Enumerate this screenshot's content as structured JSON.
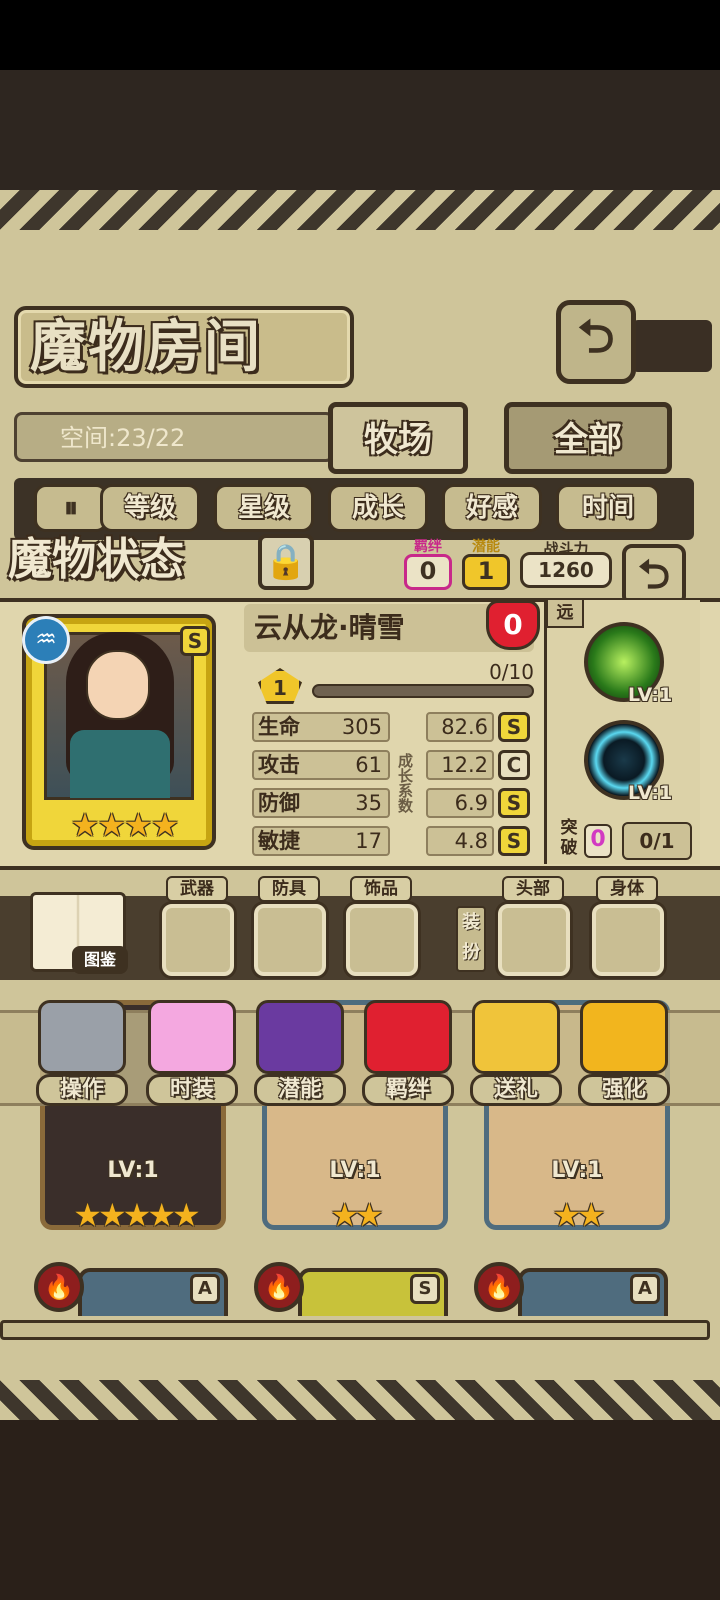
{
  "header": {
    "title": "魔物房间",
    "back_symbol": "⮌"
  },
  "space": {
    "label": "空间:23/22"
  },
  "tabs": [
    {
      "label": "牧场"
    },
    {
      "label": "全部"
    }
  ],
  "sort": {
    "toggle": "⏸",
    "options": [
      "等级",
      "星级",
      "成长",
      "好感",
      "时间"
    ]
  },
  "status": {
    "title": "魔物状态",
    "lock_symbol": "🔒",
    "bond_label": "羁绊",
    "bond_value": "0",
    "potential_label": "潜能",
    "potential_value": "1",
    "power_label": "战斗力",
    "power_value": "1260",
    "back_symbol": "⮌"
  },
  "monster": {
    "name": "云从龙·晴雪",
    "element_icon": "water-element-icon",
    "element_symbol": "♒",
    "grade": "S",
    "stars": "★★★★",
    "affection": "0",
    "level": "1",
    "xp": "0/10",
    "xp_fraction": 0.0,
    "range": "远",
    "growth_label": "成长系数",
    "stats": [
      {
        "label": "生命",
        "value": "305",
        "coef": "82.6",
        "grade": "S",
        "grade_color": "#f0d63a"
      },
      {
        "label": "攻击",
        "value": "61",
        "coef": "12.2",
        "grade": "C",
        "grade_color": "#e8dfbf"
      },
      {
        "label": "防御",
        "value": "35",
        "coef": "6.9",
        "grade": "S",
        "grade_color": "#f0d63a"
      },
      {
        "label": "敏捷",
        "value": "17",
        "coef": "4.8",
        "grade": "S",
        "grade_color": "#f0d63a"
      }
    ],
    "skills": [
      {
        "icon": "sword-slash-skill-icon",
        "level": "LV:1"
      },
      {
        "icon": "whirl-skill-icon",
        "level": "LV:1"
      }
    ],
    "breakthrough": {
      "label": "突破",
      "count": "0",
      "progress": "0/1"
    }
  },
  "equipment": {
    "book_label": "图鉴",
    "slots": [
      "武器",
      "防具",
      "饰品",
      "头部",
      "身体"
    ],
    "dress_label": "装扮"
  },
  "actions": [
    {
      "label": "操作",
      "icon": "gear-icon",
      "color": "#9aa0a8"
    },
    {
      "label": "时装",
      "icon": "outfit-icon",
      "color": "#f4a8e0"
    },
    {
      "label": "潜能",
      "icon": "shadow-potential-icon",
      "color": "#6a3aa0"
    },
    {
      "label": "羁绊",
      "icon": "hearts-icon",
      "color": "#e02030"
    },
    {
      "label": "送礼",
      "icon": "gift-icon",
      "color": "#f0c43a"
    },
    {
      "label": "强化",
      "icon": "upgrade-arrows-icon",
      "color": "#f2b51e"
    }
  ],
  "cards": [
    {
      "level": "LV:1",
      "stars": "★★★★★",
      "frame_color": "#8a6a3a"
    },
    {
      "level": "LV:1",
      "stars": "★★",
      "frame_color": "#4f6c7e"
    },
    {
      "level": "LV:1",
      "stars": "★★",
      "frame_color": "#4f6c7e"
    }
  ],
  "row2": [
    {
      "grade": "A",
      "frame_color": "#4f6c7e"
    },
    {
      "grade": "S",
      "frame_color": "#c8c23a"
    },
    {
      "grade": "A",
      "frame_color": "#4f6c7e"
    }
  ],
  "fire_symbol": "🔥"
}
